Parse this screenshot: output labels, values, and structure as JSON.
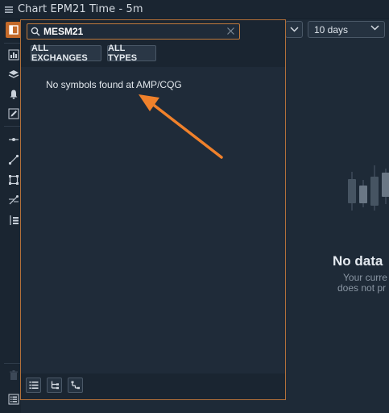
{
  "window": {
    "title": "Chart EPM21 Time - 5m"
  },
  "toolbar": {
    "icons": [
      "panel-toggle-icon",
      "chart-type-icon",
      "layers-icon",
      "alert-icon",
      "pencil-icon",
      "horizontal-line-icon",
      "trend-line-icon",
      "rectangle-icon",
      "fib-icon",
      "object-tree-icon",
      "trash-icon",
      "list-icon"
    ]
  },
  "chart_header": {
    "info_icon": "info-icon",
    "timeframe_value": "10 days"
  },
  "symbol_search": {
    "query": "MESM21",
    "filters": {
      "exchanges_label": "ALL EXCHANGES",
      "types_label": "ALL TYPES"
    },
    "message": "No symbols found at AMP/CQG",
    "footer_icons": [
      "list-view-icon",
      "tree-view-icon",
      "tree-branch-icon"
    ]
  },
  "empty_state": {
    "title": "No data",
    "line1": "Your curre",
    "line2": "does not pr"
  },
  "colors": {
    "accent": "#c46a2a",
    "arrow": "#f0812b",
    "background": "#1e2a37"
  }
}
